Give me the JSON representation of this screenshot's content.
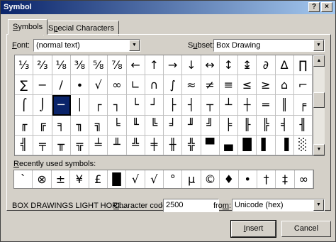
{
  "window": {
    "title": "Symbol",
    "help_glyph": "?",
    "close_glyph": "×"
  },
  "tabs": [
    {
      "label_pre": "",
      "label_u": "S",
      "label_post": "ymbols",
      "active": true
    },
    {
      "label_pre": "S",
      "label_u": "p",
      "label_post": "ecial Characters",
      "active": false
    }
  ],
  "font": {
    "label_u": "F",
    "label_post": "ont:",
    "value": "(normal text)"
  },
  "subset": {
    "label_pre": "S",
    "label_u": "u",
    "label_post": "bset:",
    "value": "Box Drawing"
  },
  "symbol_grid": [
    [
      "⅓",
      "⅔",
      "⅛",
      "⅜",
      "⅝",
      "⅞",
      "←",
      "↑",
      "→",
      "↓",
      "↔",
      "↕",
      "↨",
      "∂",
      "∆",
      "∏"
    ],
    [
      "∑",
      "−",
      "∕",
      "∙",
      "√",
      "∞",
      "∟",
      "∩",
      "∫",
      "≈",
      "≠",
      "≡",
      "≤",
      "≥",
      "⌂",
      "⌐"
    ],
    [
      "⌠",
      "⌡",
      "─",
      "│",
      "┌",
      "┐",
      "└",
      "┘",
      "├",
      "┤",
      "┬",
      "┴",
      "┼",
      "═",
      "║",
      "╒"
    ],
    [
      "╓",
      "╔",
      "╕",
      "╖",
      "╗",
      "╘",
      "╙",
      "╚",
      "╛",
      "╜",
      "╝",
      "╞",
      "╟",
      "╠",
      "╡",
      "╢"
    ],
    [
      "╣",
      "╤",
      "╥",
      "╦",
      "╧",
      "╨",
      "╩",
      "╪",
      "╫",
      "╬",
      "▀",
      "▄",
      "█",
      "▌",
      "▐",
      "░"
    ]
  ],
  "selected_symbol": "─",
  "recent": {
    "label_pre": "",
    "label_u": "R",
    "label_post": "ecently used symbols:",
    "symbols": [
      "`",
      "⊗",
      "±",
      "¥",
      "£",
      "█",
      "√",
      "√",
      "°",
      "µ",
      "©",
      "♦",
      "•",
      "†",
      "‡",
      "∞",
      "é"
    ]
  },
  "char_name": "BOX DRAWINGS LIGHT HORI...",
  "char_code": {
    "label_pre": "",
    "label_u": "C",
    "label_post": "haracter code:",
    "value": "2500"
  },
  "from": {
    "label_pre": "fro",
    "label_u": "m",
    "label_post": ":",
    "value": "Unicode (hex)"
  },
  "buttons": {
    "insert": {
      "pre": "",
      "u": "I",
      "post": "nsert"
    },
    "cancel": {
      "label": "Cancel"
    }
  }
}
